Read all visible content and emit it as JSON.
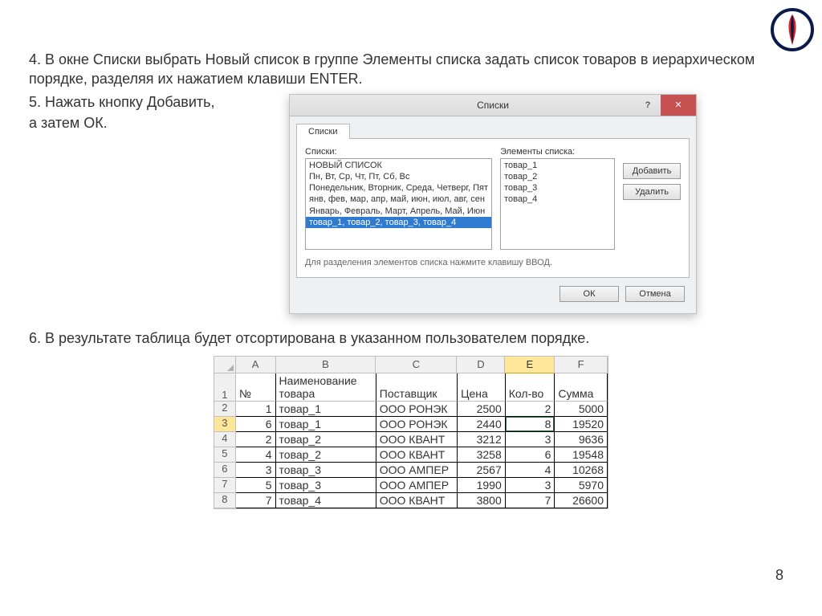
{
  "text": {
    "step4": "4. В окне Списки выбрать Новый список в группе Элементы списка задать список товаров в иерархическом порядке, разделяя их нажатием клавиши ENTER.",
    "step5a": "5. Нажать кнопку Добавить,",
    "step5b": " а затем ОК.",
    "step6": "6. В результате таблица будет отсортирована в указанном пользователем порядке.",
    "page_num": "8"
  },
  "dialog": {
    "title": "Списки",
    "tab": "Списки",
    "lists_label": "Списки:",
    "elements_label": "Элементы списка:",
    "lists": [
      "НОВЫЙ СПИСОК",
      "Пн, Вт, Ср, Чт, Пт, Сб, Вс",
      "Понедельник, Вторник, Среда, Четверг, Пят",
      "янв, фев, мар, апр, май, июн, июл, авг, сен",
      "Январь, Февраль, Март, Апрель, Май, Июн",
      "товар_1, товар_2, товар_3, товар_4"
    ],
    "elements": [
      "товар_1",
      "товар_2",
      "товар_3",
      "товар_4"
    ],
    "btn_add": "Добавить",
    "btn_del": "Удалить",
    "hint": "Для разделения элементов списка нажмите клавишу ВВОД.",
    "ok": "ОК",
    "cancel": "Отмена"
  },
  "excel": {
    "cols": [
      "A",
      "B",
      "C",
      "D",
      "E",
      "F"
    ],
    "active_col_index": 4,
    "rows": [
      {
        "n": "1",
        "cells": [
          "№",
          "Наименование товара",
          "Поставщик",
          "Цена",
          "Кол-во",
          "Сумма"
        ],
        "header": true
      },
      {
        "n": "2",
        "cells": [
          "1",
          "товар_1",
          "ООО РОНЭК",
          "2500",
          "2",
          "5000"
        ]
      },
      {
        "n": "3",
        "cells": [
          "6",
          "товар_1",
          "ООО РОНЭК",
          "2440",
          "8",
          "19520"
        ],
        "sel": true
      },
      {
        "n": "4",
        "cells": [
          "2",
          "товар_2",
          "ООО КВАНТ",
          "3212",
          "3",
          "9636"
        ]
      },
      {
        "n": "5",
        "cells": [
          "4",
          "товар_2",
          "ООО КВАНТ",
          "3258",
          "6",
          "19548"
        ]
      },
      {
        "n": "6",
        "cells": [
          "3",
          "товар_3",
          "ООО АМПЕР",
          "2567",
          "4",
          "10268"
        ]
      },
      {
        "n": "7",
        "cells": [
          "5",
          "товар_3",
          "ООО АМПЕР",
          "1990",
          "3",
          "5970"
        ]
      },
      {
        "n": "8",
        "cells": [
          "7",
          "товар_4",
          "ООО КВАНТ",
          "3800",
          "7",
          "26600"
        ]
      }
    ]
  }
}
